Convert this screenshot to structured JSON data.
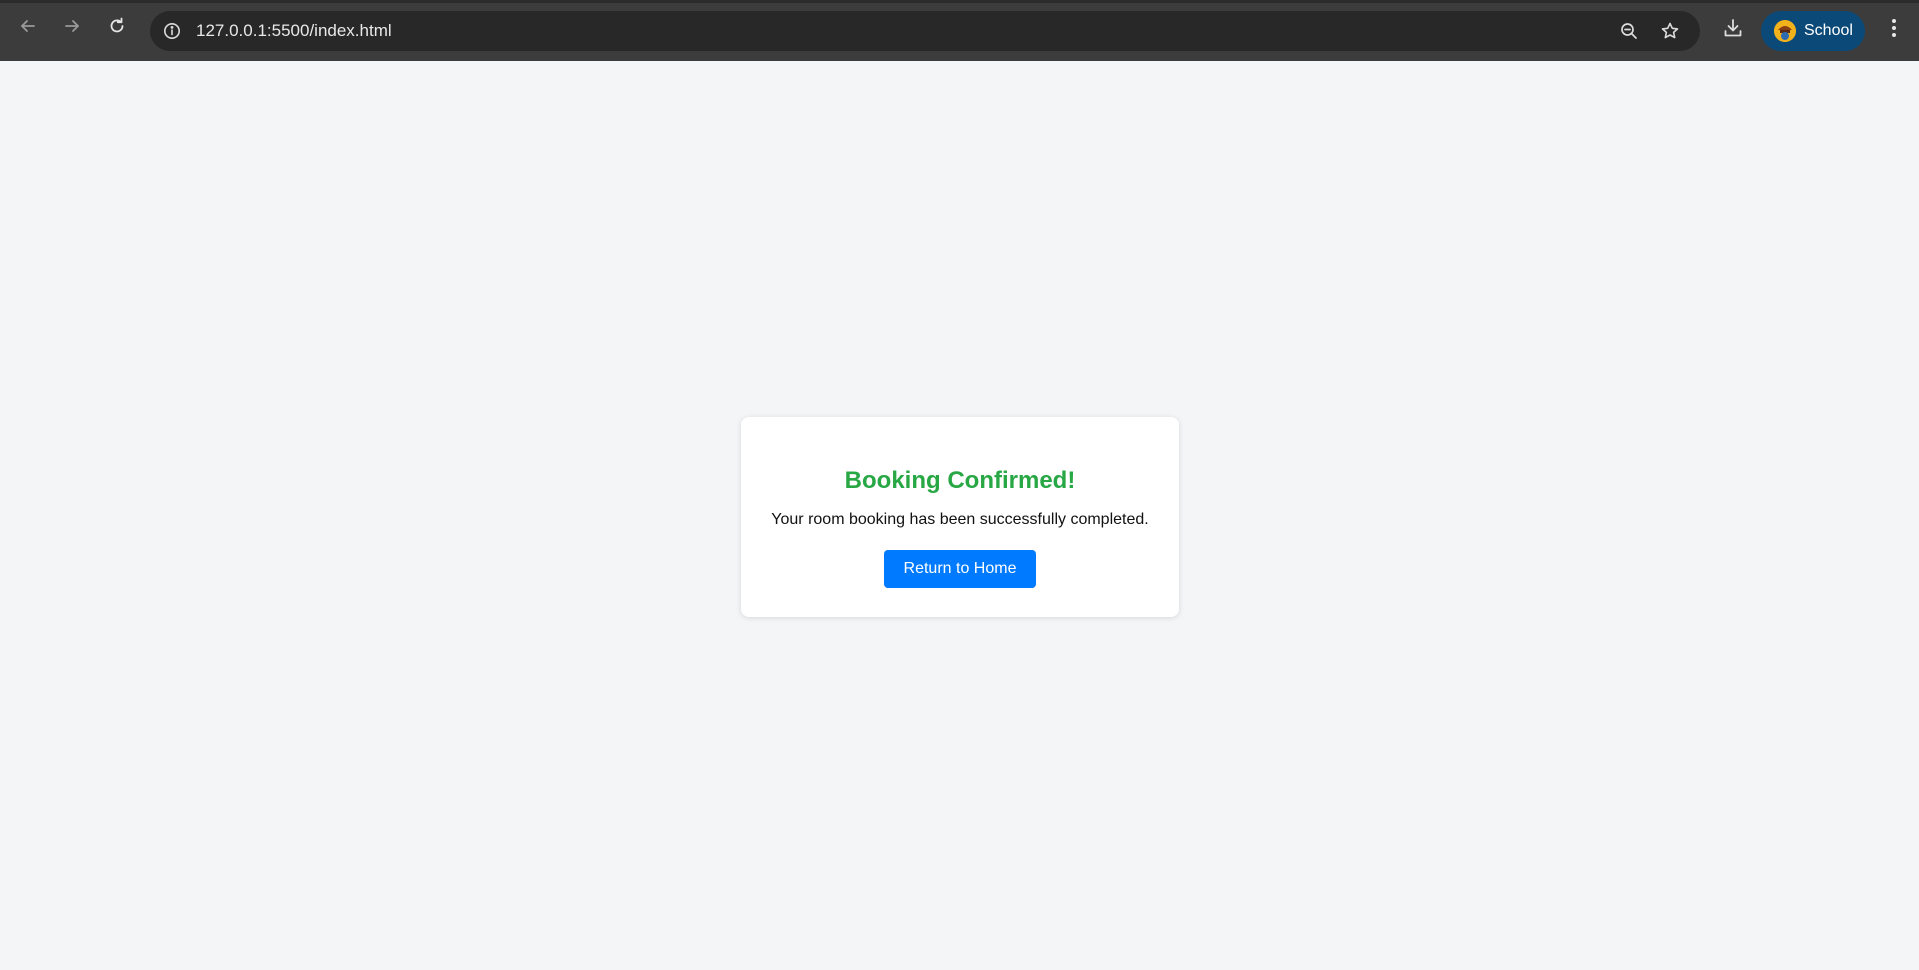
{
  "browser": {
    "url": "127.0.0.1:5500/index.html",
    "profile_name": "School",
    "icons": {
      "back": "arrow-left-icon",
      "forward": "arrow-right-icon",
      "reload": "reload-icon",
      "site_info": "info-icon",
      "zoom": "zoom-out-icon",
      "bookmark": "star-icon",
      "download": "download-icon",
      "menu": "kebab-menu-icon"
    },
    "colors": {
      "toolbar": "#3c3c3c",
      "omnibox": "#282828",
      "profile_chip": "#0b4a78"
    }
  },
  "page": {
    "background": "#f4f5f7",
    "card": {
      "title": "Booking Confirmed!",
      "message": "Your room booking has been successfully completed.",
      "button_label": "Return to Home"
    },
    "colors": {
      "title": "#28a745",
      "button": "#007bff"
    }
  }
}
